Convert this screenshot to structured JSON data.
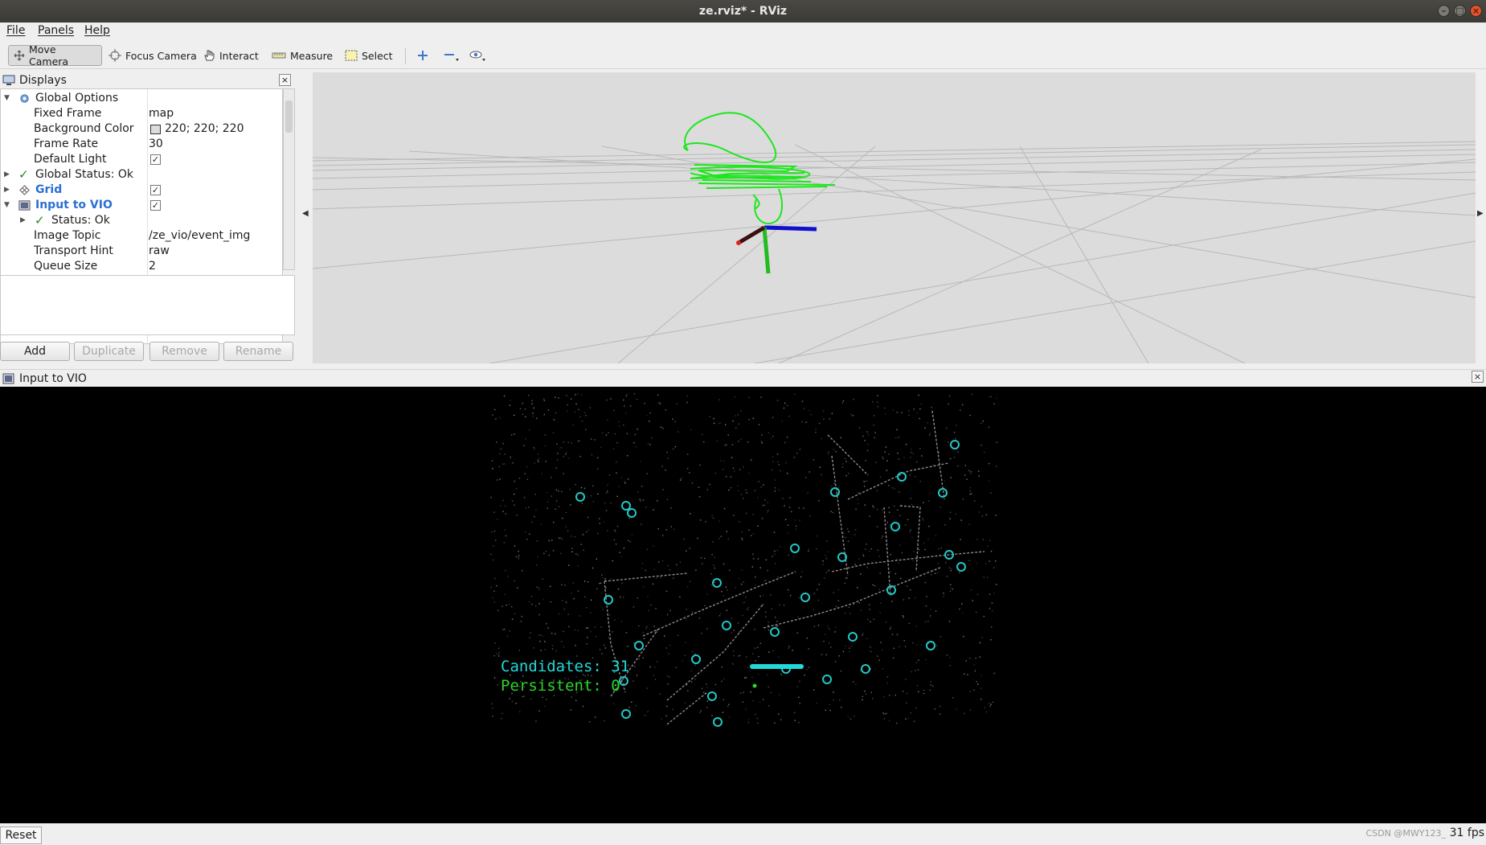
{
  "window": {
    "title": "ze.rviz* - RViz"
  },
  "menubar": {
    "items": [
      "File",
      "Panels",
      "Help"
    ]
  },
  "toolbar": {
    "tools": [
      "Move Camera",
      "Focus Camera",
      "Interact",
      "Measure",
      "Select"
    ],
    "active": "Move Camera"
  },
  "displays": {
    "title": "Displays",
    "rows": [
      {
        "label": "Global Options"
      },
      {
        "label": "Fixed Frame",
        "value": "map"
      },
      {
        "label": "Background Color",
        "value": "220; 220; 220"
      },
      {
        "label": "Frame Rate",
        "value": "30"
      },
      {
        "label": "Default Light",
        "checked": true
      },
      {
        "label": "Global Status: Ok"
      },
      {
        "label": "Grid",
        "checked": true
      },
      {
        "label": "Input to VIO",
        "checked": true
      },
      {
        "label": "Status: Ok"
      },
      {
        "label": "Image Topic",
        "value": "/ze_vio/event_img"
      },
      {
        "label": "Transport Hint",
        "value": "raw"
      },
      {
        "label": "Queue Size",
        "value": "2"
      }
    ],
    "buttons": {
      "add": "Add",
      "duplicate": "Duplicate",
      "remove": "Remove",
      "rename": "Rename"
    }
  },
  "viewport": {
    "background_color": "#dcdcdc",
    "trajectory_color": "#1ee61e"
  },
  "image_panel": {
    "title": "Input to VIO",
    "overlay": {
      "candidates_text": "Candidates: 31",
      "persistent_text": "Persistent: 0",
      "candidates_color": "#22d8d8",
      "persistent_color": "#28d828"
    },
    "feature_color": "#22c8c8"
  },
  "statusbar": {
    "reset": "Reset",
    "fps": "31 fps",
    "watermark": "CSDN @MWY123_"
  }
}
